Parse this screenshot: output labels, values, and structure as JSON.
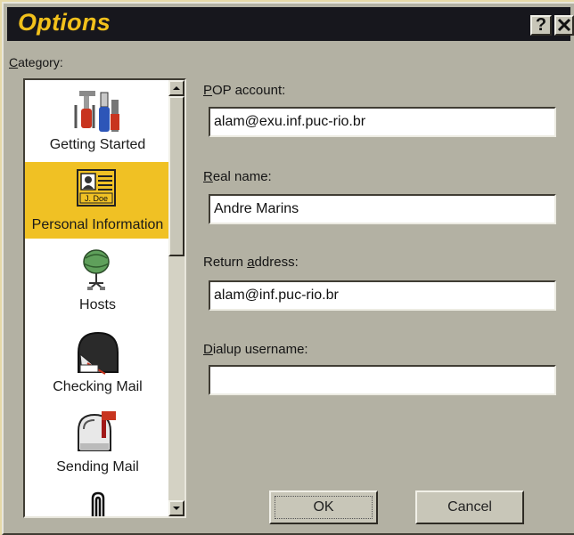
{
  "window": {
    "title": "Options",
    "help_glyph": "?",
    "close_glyph": "✕"
  },
  "category": {
    "label_accel": "C",
    "label_rest": "ategory:",
    "items": [
      {
        "label": "Getting Started",
        "icon": "tools-icon"
      },
      {
        "label": "Personal Information",
        "icon": "id-card-icon",
        "selected": true,
        "card_text": "J. Doe"
      },
      {
        "label": "Hosts",
        "icon": "network-globe-icon"
      },
      {
        "label": "Checking Mail",
        "icon": "mailbox-open-icon"
      },
      {
        "label": "Sending Mail",
        "icon": "mailbox-flag-icon"
      },
      {
        "label": "",
        "icon": "paperclip-icon"
      }
    ]
  },
  "fields": {
    "pop_account": {
      "label_accel": "P",
      "label_rest": "OP account:",
      "value": "alam@exu.inf.puc-rio.br"
    },
    "real_name": {
      "label_accel": "R",
      "label_rest": "eal name:",
      "value": "Andre Marins"
    },
    "return_address": {
      "label_pre": "Return ",
      "label_accel": "a",
      "label_rest": "ddress:",
      "value": "alam@inf.puc-rio.br"
    },
    "dialup_username": {
      "label_accel": "D",
      "label_rest": "ialup username:",
      "value": ""
    }
  },
  "buttons": {
    "ok": "OK",
    "cancel": "Cancel"
  },
  "colors": {
    "accent_yellow": "#f0c124",
    "title_text": "#f2c11b",
    "titlebar_bg": "#17171d",
    "dialog_bg": "#b3b1a3"
  }
}
